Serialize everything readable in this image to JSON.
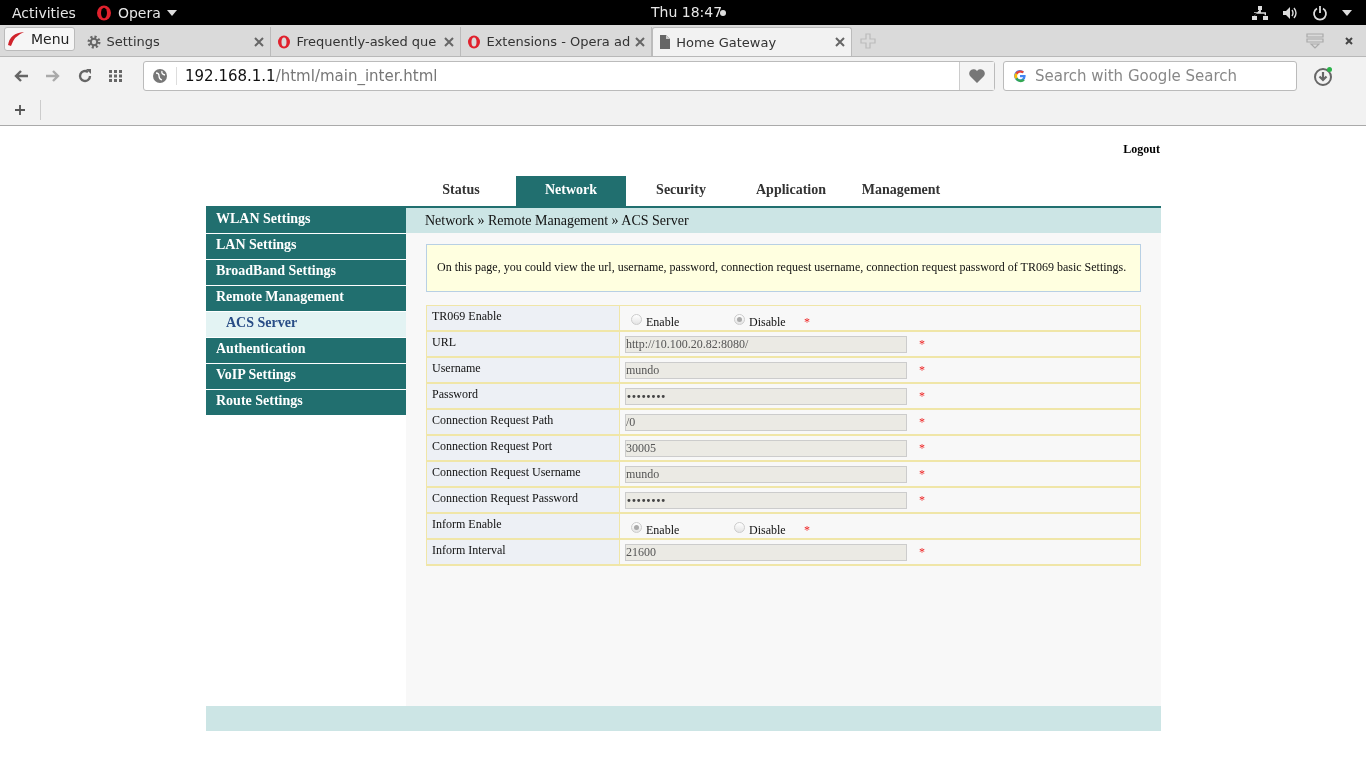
{
  "system_bar": {
    "activities": "Activities",
    "app": "Opera",
    "clock": "Thu 18:47"
  },
  "browser_tabs": [
    {
      "kind": "settings",
      "title": "Settings",
      "selected": false
    },
    {
      "kind": "opera",
      "title": "Frequently-asked que",
      "selected": false
    },
    {
      "kind": "opera",
      "title": "Extensions - Opera ad",
      "selected": false
    },
    {
      "kind": "page",
      "title": "Home Gateway",
      "selected": true
    }
  ],
  "menu_button": "Menu",
  "address_bar": {
    "host": "192.168.1.1",
    "path": "/html/main_inter.html"
  },
  "search": {
    "placeholder": "Search with Google Search"
  },
  "logout": "Logout",
  "nav_tabs": [
    {
      "label": "Status",
      "selected": false
    },
    {
      "label": "Network",
      "selected": true
    },
    {
      "label": "Security",
      "selected": false
    },
    {
      "label": "Application",
      "selected": false
    },
    {
      "label": "Management",
      "selected": false
    }
  ],
  "sidebar": {
    "items": [
      {
        "label": "WLAN Settings",
        "selected": false
      },
      {
        "label": "LAN Settings",
        "selected": false
      },
      {
        "label": "BroadBand Settings",
        "selected": false
      },
      {
        "label": "Remote Management",
        "selected": false,
        "children": [
          {
            "label": "ACS Server",
            "selected": true
          }
        ]
      },
      {
        "label": "Authentication",
        "selected": false
      },
      {
        "label": "VoIP Settings",
        "selected": false
      },
      {
        "label": "Route Settings",
        "selected": false
      }
    ]
  },
  "breadcrumb": "Network » Remote Management » ACS Server",
  "notice": "On this page, you could view the url, username, password, connection request username, connection request password of TR069 basic Settings.",
  "form": {
    "rows": [
      {
        "kind": "radio",
        "label": "TR069 Enable",
        "required_mark": "*",
        "options": [
          {
            "label": "Enable",
            "selected": false
          },
          {
            "label": "Disable",
            "selected": true
          }
        ]
      },
      {
        "kind": "text",
        "label": "URL",
        "value": "http://10.100.20.82:8080/",
        "required_mark": "*"
      },
      {
        "kind": "text",
        "label": "Username",
        "value": "mundo",
        "required_mark": "*"
      },
      {
        "kind": "password",
        "label": "Password",
        "value": "••••••••",
        "required_mark": "*"
      },
      {
        "kind": "text",
        "label": "Connection Request Path",
        "value": "/0",
        "required_mark": "*"
      },
      {
        "kind": "text",
        "label": "Connection Request Port",
        "value": "30005",
        "required_mark": "*"
      },
      {
        "kind": "text",
        "label": "Connection Request Username",
        "value": "mundo",
        "required_mark": "*"
      },
      {
        "kind": "password",
        "label": "Connection Request Password",
        "value": "••••••••",
        "required_mark": "*"
      },
      {
        "kind": "radio",
        "label": "Inform Enable",
        "required_mark": "*",
        "options": [
          {
            "label": "Enable",
            "selected": true
          },
          {
            "label": "Disable",
            "selected": false
          }
        ]
      },
      {
        "kind": "text",
        "label": "Inform Interval",
        "value": "21600",
        "required_mark": "*"
      }
    ]
  }
}
